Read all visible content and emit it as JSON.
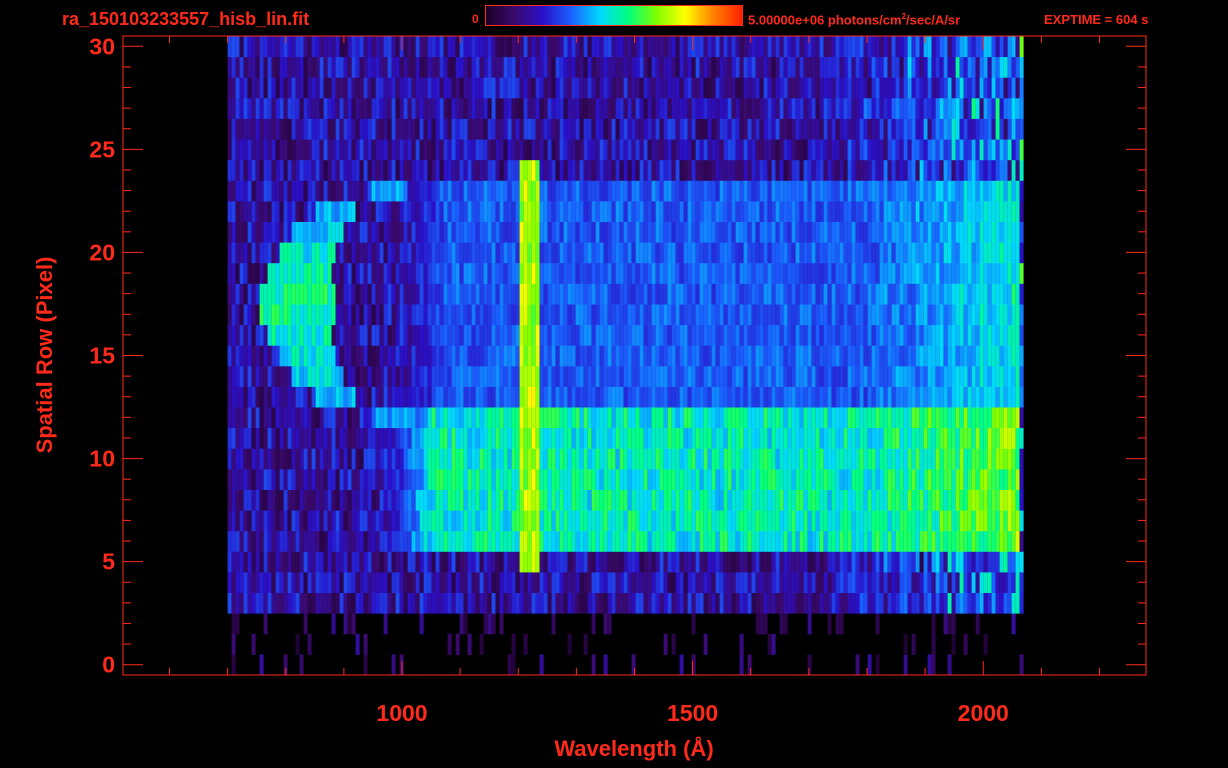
{
  "file_title": "ra_150103233557_hisb_lin.fit",
  "colorbar": {
    "min_label": "0",
    "max_label_pre": "5.00000e+06 photons/cm",
    "max_label_sup": "2",
    "max_label_post": "/sec/A/sr",
    "stops": [
      "#1a0026",
      "#3a0a6e",
      "#2a10c8",
      "#1a60ff",
      "#00d8ff",
      "#00ff80",
      "#80ff00",
      "#ffff00",
      "#ff8000",
      "#ff2000"
    ]
  },
  "exptime_label": "EXPTIME = 604 s",
  "accent_color": "#ff2a1a",
  "chart_data": {
    "type": "heatmap",
    "title": "ra_150103233557_hisb_lin.fit",
    "xlabel": "Wavelength (Å)",
    "ylabel": "Spatial Row (Pixel)",
    "xlim": [
      520,
      2280
    ],
    "ylim": [
      -0.5,
      30.5
    ],
    "x_ticks": [
      1000,
      1500,
      2000
    ],
    "x_tick_labels": [
      "1000",
      "1500",
      "2000"
    ],
    "y_ticks": [
      0,
      5,
      10,
      15,
      20,
      25,
      30
    ],
    "y_tick_labels": [
      "0",
      "5",
      "10",
      "15",
      "20",
      "25",
      "30"
    ],
    "x_minor_step": 100,
    "y_minor_step": 1,
    "grid": false,
    "colorscale": [
      "#1a0026",
      "#3a0a6e",
      "#2a10c8",
      "#1a60ff",
      "#00d8ff",
      "#00ff80",
      "#80ff00",
      "#ffff00",
      "#ff8000",
      "#ff2000"
    ],
    "value_range": [
      0,
      5000000
    ],
    "value_unit": "photons/cm^2/sec/A/sr",
    "detector_extent_x": [
      700,
      2065
    ],
    "features": [
      {
        "kind": "background",
        "x_range": [
          700,
          2065
        ],
        "y_range": [
          3,
          30
        ],
        "level": 0.18
      },
      {
        "kind": "arc",
        "center_x": 975,
        "center_y": 17.5,
        "radius_x": 160,
        "radius_y": 5.5,
        "x_range": [
          790,
          990
        ],
        "y_range": [
          12,
          23
        ],
        "level": 0.55
      },
      {
        "kind": "band",
        "x_range": [
          930,
          2060
        ],
        "y_range": [
          6,
          12
        ],
        "level": 0.5
      },
      {
        "kind": "band",
        "x_range": [
          950,
          2060
        ],
        "y_range": [
          12,
          23
        ],
        "level": 0.32
      },
      {
        "kind": "line",
        "x": 1215,
        "y_range": [
          5,
          24
        ],
        "level": 0.72
      }
    ]
  }
}
